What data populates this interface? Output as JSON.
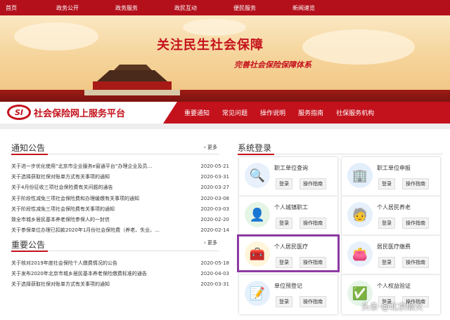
{
  "topnav": [
    "首页",
    "政务公开",
    "政务服务",
    "政民互动",
    "便民服务",
    "新闻速览"
  ],
  "banner": {
    "title": "关注民生社会保障",
    "subtitle": "完善社会保险保障体系"
  },
  "logo": {
    "mark": "SI",
    "text": "社会保险网上服务平台"
  },
  "subnav": [
    "重要通知",
    "常见问题",
    "操作说明",
    "服务指南",
    "社保服务机构"
  ],
  "notice": {
    "title": "通知公告",
    "more": "更多",
    "items": [
      {
        "title": "关于进一步优化使用“北京市企业服务e窗通平台”办理企业及员...",
        "date": "2020-05-21"
      },
      {
        "title": "关于选择获取社保对账单方式有关事项的通知",
        "date": "2020-03-31"
      },
      {
        "title": "关于4月份征收三项社会保险费有关问题的通告",
        "date": "2020-03-27"
      },
      {
        "title": "关于阶段性减免三项社会保险费和办理缓缴有关事项的通知",
        "date": "2020-03-08"
      },
      {
        "title": "关于阶段性减免三项社会保险费有关事项的通知",
        "date": "2020-03-03"
      },
      {
        "title": "致全市城乡居民基本养老保险参保人的一封信",
        "date": "2020-02-20"
      },
      {
        "title": "关于参保单位办理已扣款2020年1月份社会保险费（养老、失业、...",
        "date": "2020-02-14"
      }
    ]
  },
  "important": {
    "title": "重要公告",
    "more": "更多",
    "items": [
      {
        "title": "关于核对2019年度社会保险个人缴费情况的公告",
        "date": "2020-05-18"
      },
      {
        "title": "关于发布2020年北京市城乡居民基本养老保险缴费标准的通告",
        "date": "2020-04-03"
      },
      {
        "title": "关于选择获取社保对账单方式有关事项的通知",
        "date": "2020-03-31"
      }
    ]
  },
  "login": {
    "title": "系统登录",
    "login_label": "登录",
    "guide_label": "操作指南",
    "cards": [
      {
        "name": "职工单位查询",
        "icon": "search-person-icon",
        "color": "#e7f0fb"
      },
      {
        "name": "职工单位申报",
        "icon": "building-icon",
        "color": "#e3eefb"
      },
      {
        "name": "个人城镇职工",
        "icon": "person-icon",
        "color": "#e5f5e5"
      },
      {
        "name": "个人居民养老",
        "icon": "elderly-icon",
        "color": "#e6f0fb"
      },
      {
        "name": "个人居民医疗",
        "icon": "medical-kit-icon",
        "color": "#fff5da"
      },
      {
        "name": "居民医疗缴费",
        "icon": "wallet-icon",
        "color": "#e8f0fb"
      },
      {
        "name": "单位预登记",
        "icon": "register-icon",
        "color": "#e5f0fb"
      },
      {
        "name": "个人权益验证",
        "icon": "verify-icon",
        "color": "#e5f5e8"
      }
    ]
  },
  "watermark": "头条 @北京顺义",
  "colors": {
    "brand_red": "#c4121c",
    "highlight": "#8d3aa3"
  }
}
